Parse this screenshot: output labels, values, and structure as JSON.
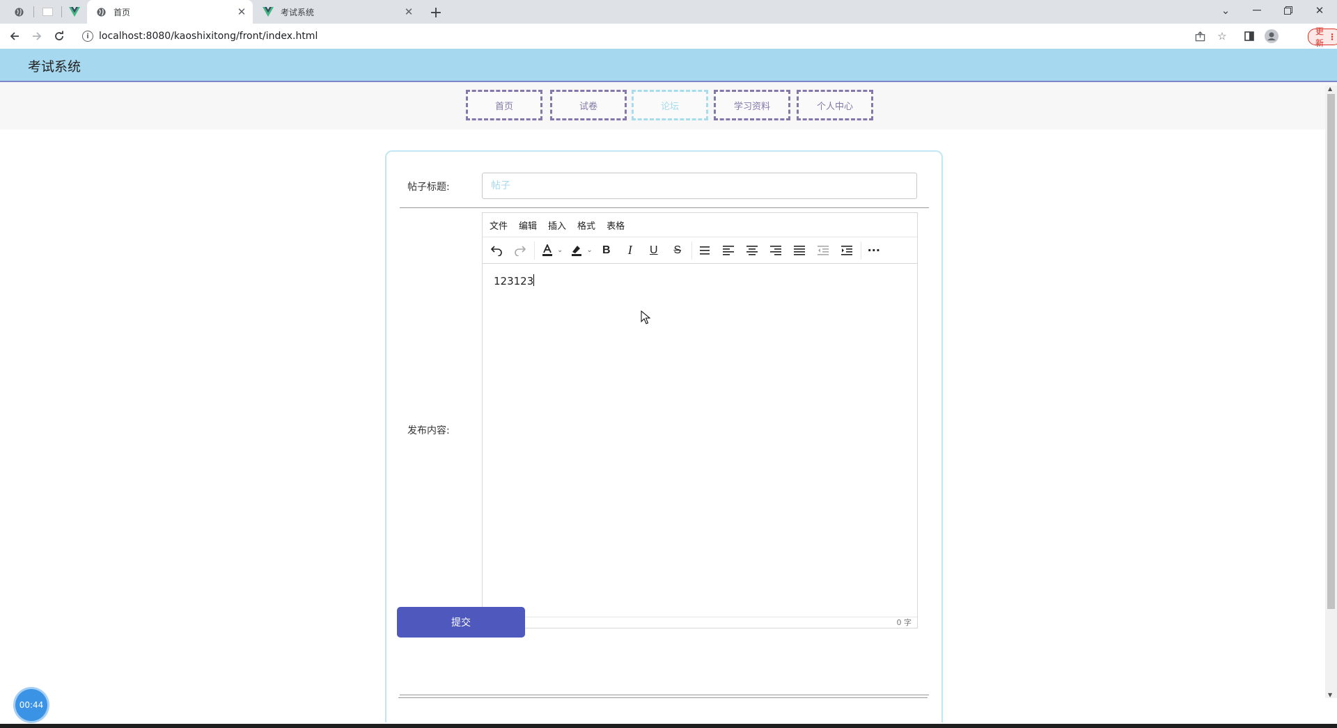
{
  "browser": {
    "tabs": [
      {
        "label": "首页",
        "active": true
      },
      {
        "label": "考试系统",
        "active": false
      }
    ],
    "url": "localhost:8080/kaoshixitong/front/index.html",
    "update_label": "更新"
  },
  "site": {
    "title": "考试系统",
    "nav": [
      {
        "label": "首页",
        "active": false
      },
      {
        "label": "试卷",
        "active": false
      },
      {
        "label": "论坛",
        "active": true
      },
      {
        "label": "学习资料",
        "active": false
      },
      {
        "label": "个人中心",
        "active": false
      }
    ]
  },
  "form": {
    "title_label": "帖子标题:",
    "title_placeholder": "帖子",
    "content_label": "发布内容:",
    "editor": {
      "menus": [
        "文件",
        "编辑",
        "插入",
        "格式",
        "表格"
      ],
      "content": "123123",
      "word_count": "0 字"
    },
    "submit_label": "提交"
  },
  "timer": "00:44",
  "colors": {
    "header_bg": "#a6d9f0",
    "nav_border": "#8377ab",
    "nav_active": "#a6dcec",
    "submit_bg": "#4f58bd"
  }
}
